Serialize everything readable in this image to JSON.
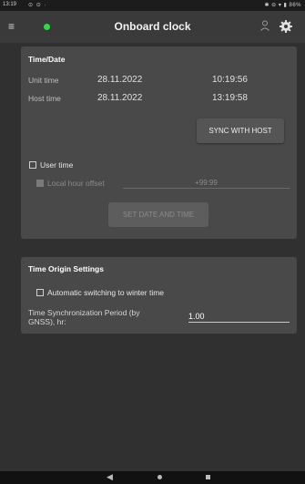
{
  "status_bar": {
    "time": "13:19",
    "icons_left": "⊙ ⊙ ·",
    "icons_right": "✱ ⊖ ▾ ▮ 86%"
  },
  "app_bar": {
    "title": "Onboard clock",
    "connection_color": "#37d64a"
  },
  "time_date": {
    "title": "Time/Date",
    "unit_label": "Unit time",
    "unit_date": "28.11.2022",
    "unit_time": "10:19:56",
    "host_label": "Host time",
    "host_date": "28.11.2022",
    "host_time": "13:19:58",
    "sync_label": "SYNC WITH HOST",
    "user_time_label": "User time",
    "local_offset_label": "Local hour offset",
    "local_offset_placeholder": "+99:99",
    "set_label": "SET DATE AND TIME"
  },
  "time_origin": {
    "title": "Time Origin Settings",
    "winter_label": "Automatic switching to winter time",
    "period_label_line1": "Time Synchronization Period (by",
    "period_label_line2": "GNSS), hr:",
    "period_value": "1.00"
  },
  "nav": {
    "back": "◀"
  },
  "colors": {
    "background": "#303030",
    "card": "#494949",
    "accent_green": "#37d64a"
  }
}
